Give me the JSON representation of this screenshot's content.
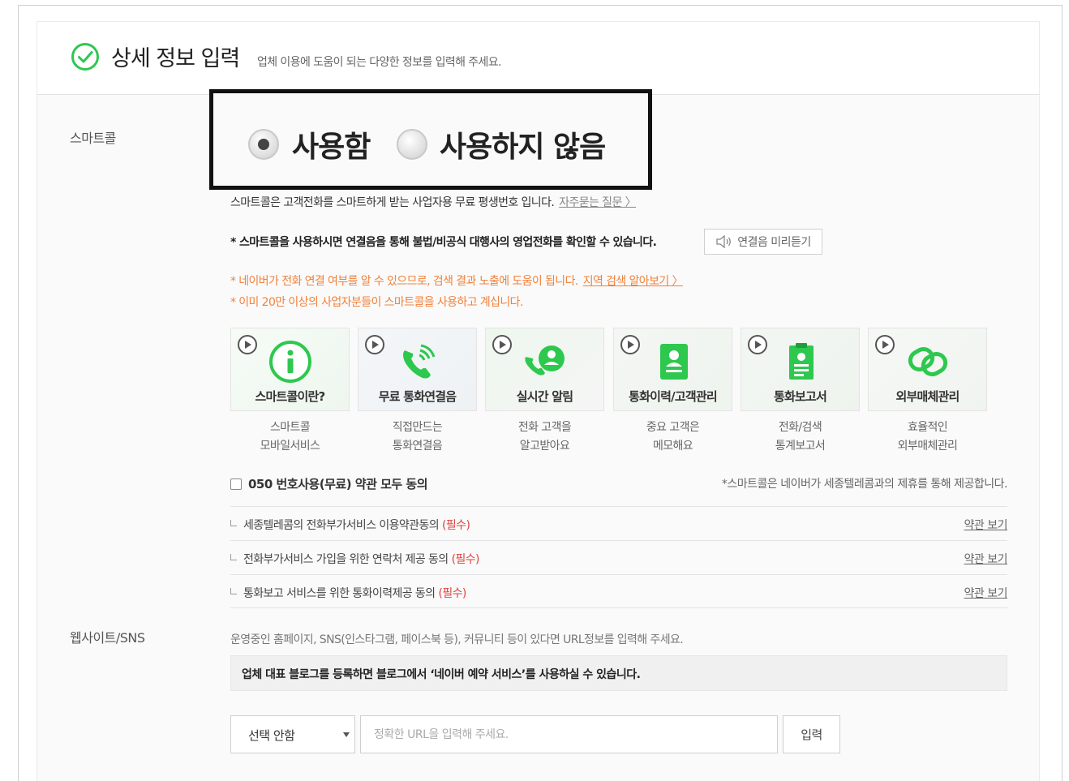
{
  "header": {
    "title": "상세 정보 입력",
    "subtitle": "업체 이용에 도움이 되는 다양한 정보를 입력해 주세요.",
    "accent": "#2ec84f"
  },
  "smartcall": {
    "label": "스마트콜",
    "options": [
      {
        "label": "사용함",
        "selected": true
      },
      {
        "label": "사용하지 않음",
        "selected": false
      }
    ],
    "description": "스마트콜은 고객전화를 스마트하게 받는 사업자용 무료 평생번호 입니다.",
    "faq_link": "자주묻는 질문 〉",
    "notice_bold": "* 스마트콜을 사용하시면 연결음을 통해 불법/비공식 대행사의 영업전화를 확인할 수 있습니다.",
    "preview_button": "연결음 미리듣기",
    "orange_note_1": "* 네이버가 전화 연결 여부를 알 수 있으므로, 검색 결과 노출에 도움이 됩니다.",
    "region_link": "지역 검색 알아보기 〉",
    "orange_note_2": "* 이미 20만 이상의 사업자분들이 스마트콜을 사용하고 계십니다.",
    "features": [
      {
        "icon": "info-icon",
        "title": "스마트콜이란?",
        "desc1": "스마트콜",
        "desc2": "모바일서비스"
      },
      {
        "icon": "phone-call-icon",
        "title": "무료 통화연결음",
        "desc1": "직접만드는",
        "desc2": "통화연결음"
      },
      {
        "icon": "realtime-alert-icon",
        "title": "실시간 알림",
        "desc1": "전화 고객을",
        "desc2": "알고받아요"
      },
      {
        "icon": "contact-card-icon",
        "title": "통화이력/고객관리",
        "desc1": "중요 고객은",
        "desc2": "메모해요"
      },
      {
        "icon": "report-icon",
        "title": "통화보고서",
        "desc1": "전화/검색",
        "desc2": "통계보고서"
      },
      {
        "icon": "link-icon",
        "title": "외부매체관리",
        "desc1": "효율적인",
        "desc2": "외부매체관리"
      }
    ],
    "agree_all": "050 번호사용(무료) 약관 모두 동의",
    "agree_note": "*스마트콜은 네이버가 세종텔레콤과의 제휴를 통해 제공합니다.",
    "terms": [
      {
        "text": "세종텔레콤의 전화부가서비스 이용약관동의",
        "required": "(필수)",
        "link": "약관 보기"
      },
      {
        "text": "전화부가서비스 가입을 위한 연락처 제공 동의",
        "required": "(필수)",
        "link": "약관 보기"
      },
      {
        "text": "통화보고 서비스를 위한 통화이력제공 동의",
        "required": "(필수)",
        "link": "약관 보기"
      }
    ]
  },
  "website": {
    "label": "웹사이트/SNS",
    "description": "운영중인 홈페이지, SNS(인스타그램, 페이스북 등), 커뮤니티 등이 있다면 URL정보를 입력해 주세요.",
    "notice": "업체 대표 블로그를 등록하면 블로그에서 ‘네이버 예약 서비스’를 사용하실 수 있습니다.",
    "select_value": "선택 안함",
    "url_placeholder": "정확한 URL을 입력해 주세요.",
    "submit_label": "입력"
  }
}
